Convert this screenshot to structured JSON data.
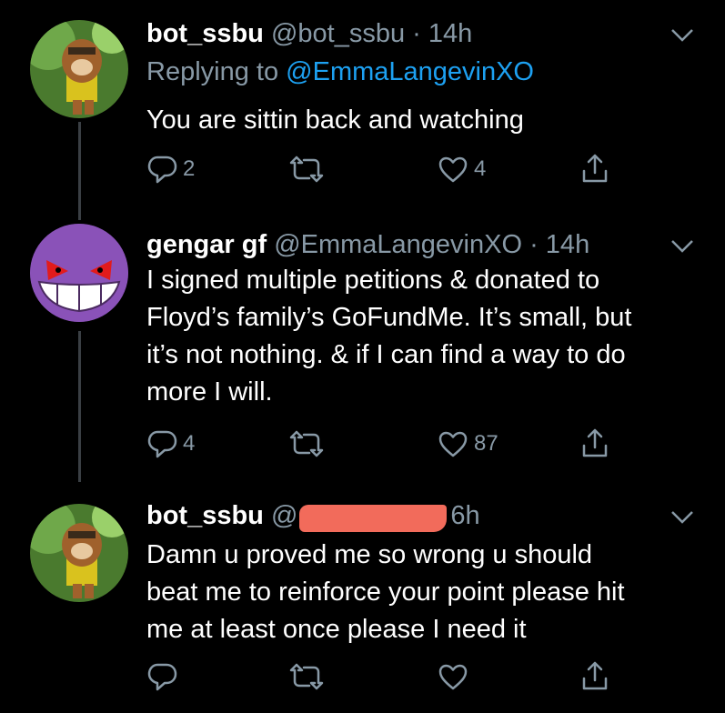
{
  "tweets": [
    {
      "name": "bot_ssbu",
      "handle": "@bot_ssbu",
      "time": "· 14h",
      "replying_prefix": "Replying to",
      "replying_to": "@EmmaLangevinXO",
      "text": "You are sittin back and watching",
      "replies": "2",
      "retweets": "",
      "likes": "4"
    },
    {
      "name": "gengar gf",
      "handle": "@EmmaLangevinXO",
      "time": "· 14h",
      "text_lines": [
        "I signed multiple petitions & donated to",
        "Floyd’s family’s GoFundMe. It’s small, but",
        "it’s not nothing. & if I can find a way to do",
        "more I will."
      ],
      "replies": "4",
      "retweets": "",
      "likes": "87"
    },
    {
      "name": "bot_ssbu",
      "handle": "@",
      "time": "6h",
      "text_lines": [
        "Damn u proved me so wrong u should",
        "beat me to reinforce your point please hit",
        "me at least once please I need it"
      ],
      "replies": "",
      "retweets": "",
      "likes": ""
    }
  ],
  "colors": {
    "background": "#000000",
    "muted": "#8899a6",
    "link": "#1da1f2",
    "redaction": "#f26b5b"
  },
  "icons": [
    "reply-icon",
    "retweet-icon",
    "like-icon",
    "share-icon",
    "chevron-down-icon"
  ]
}
